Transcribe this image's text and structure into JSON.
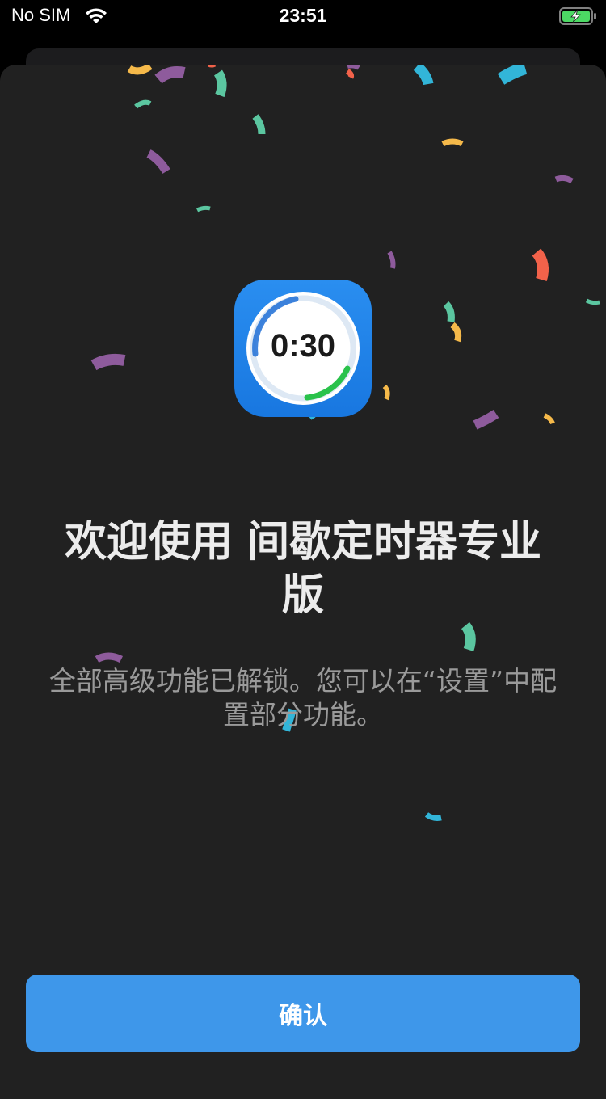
{
  "status_bar": {
    "carrier": "No SIM",
    "time": "23:51",
    "battery_color": "#4cd964"
  },
  "dialog": {
    "app_icon": {
      "time_display": "0:30",
      "background_color": "#1a7fe6",
      "ring_color": "#2ac24b"
    },
    "title": "欢迎使用 间歇定时器专业版",
    "subtitle": "全部高级功能已解锁。您可以在“设置”中配置部分功能。",
    "confirm_button_label": "确认",
    "accent_color": "#3e97ea"
  },
  "confetti_colors": [
    "#f5b94a",
    "#8e5b9c",
    "#5bc6a0",
    "#32b5d8",
    "#f2624a"
  ]
}
